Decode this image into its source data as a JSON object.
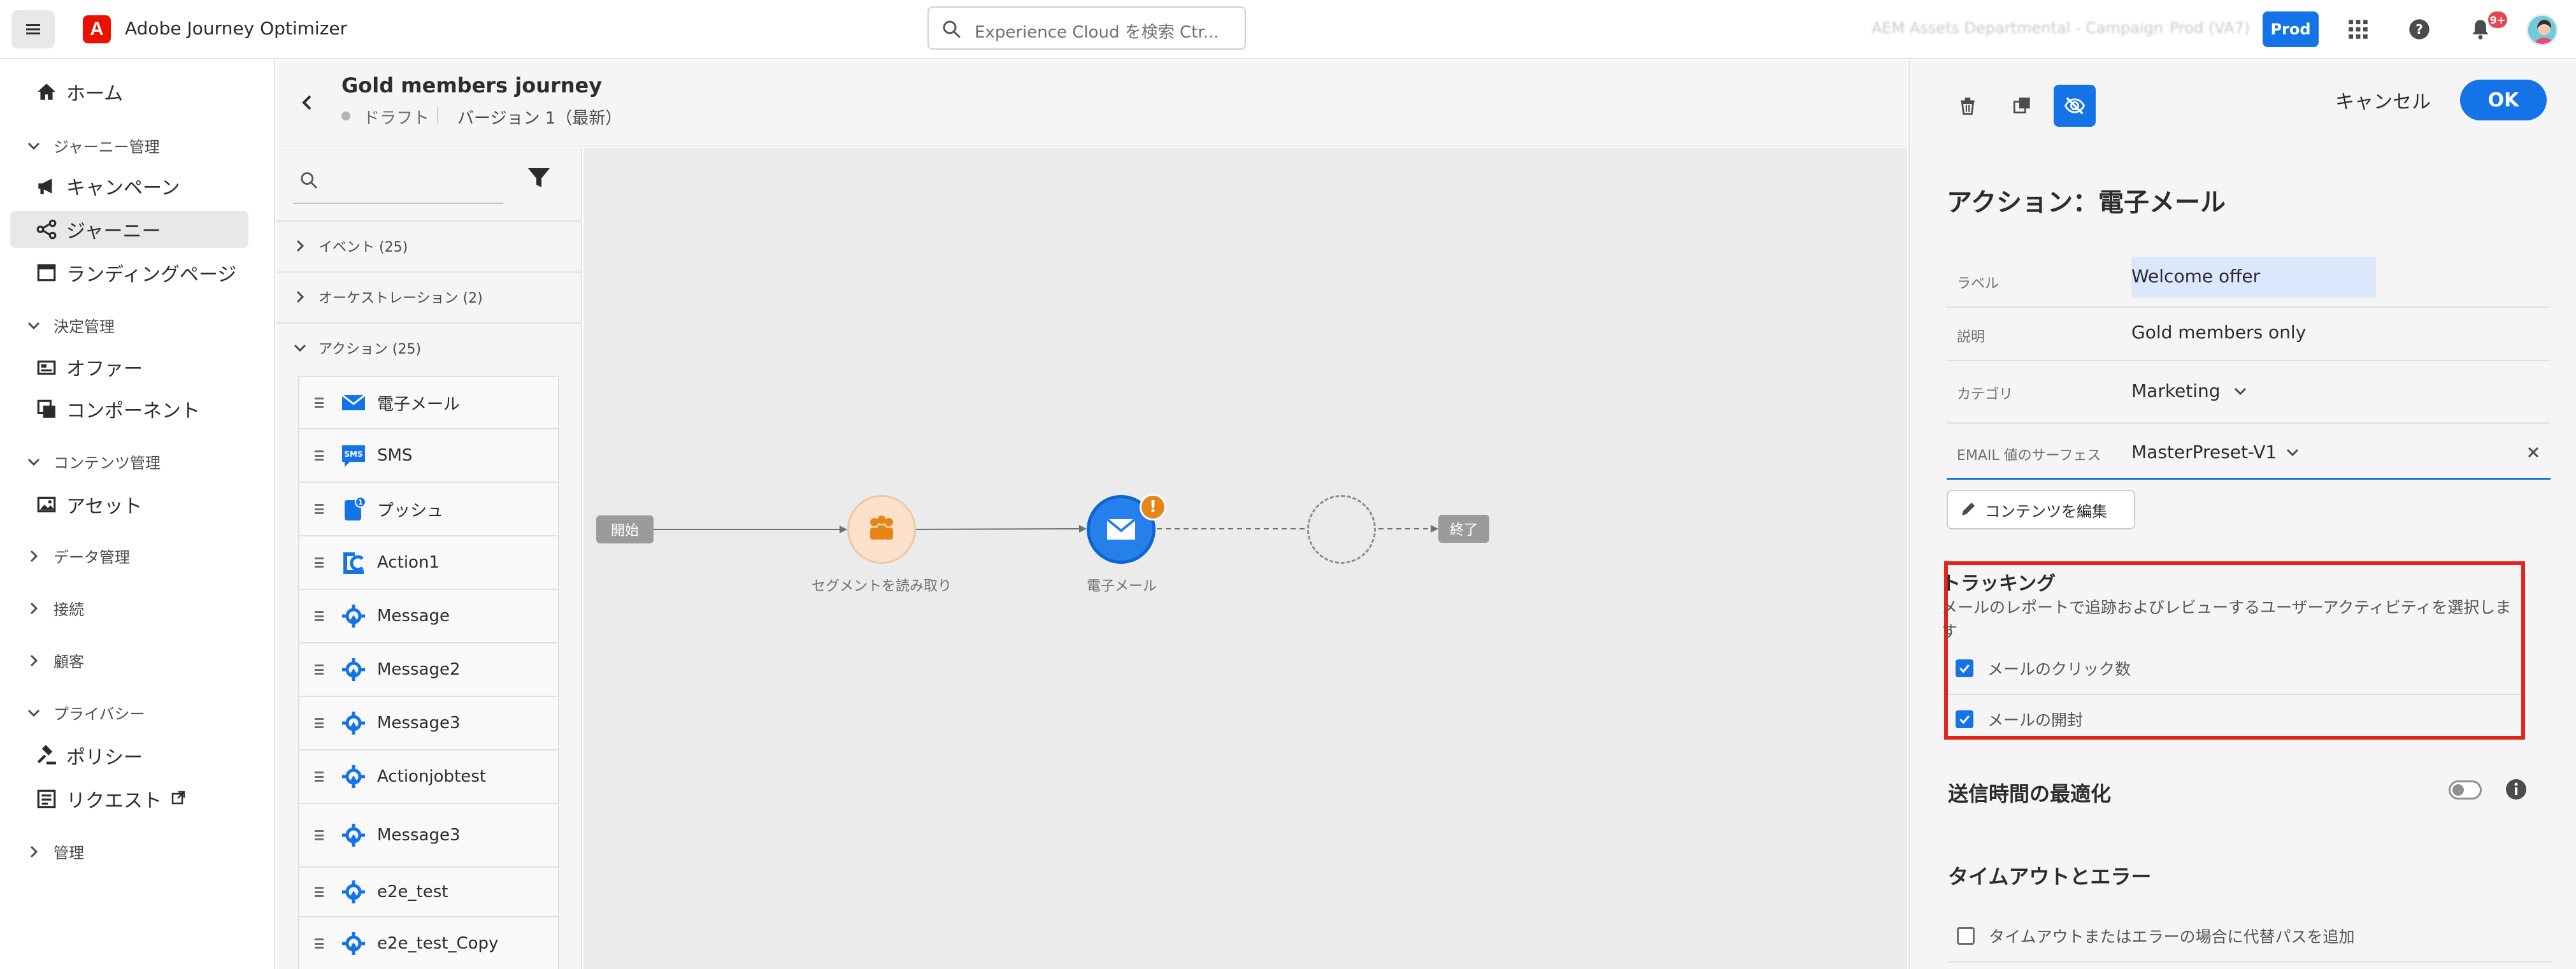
{
  "topbar": {
    "app_title": "Adobe Journey Optimizer",
    "search_placeholder": "Experience Cloud を検索 Ctr...",
    "org_name": "AEM Assets Departmental - Campaign",
    "sandbox_name": "Prod (VA7)",
    "env_button": "Prod",
    "notification_count": "9+"
  },
  "nav": {
    "home": "ホーム",
    "journey_mgmt": "ジャーニー管理",
    "campaigns": "キャンペーン",
    "journeys": "ジャーニー",
    "landing_pages": "ランディングページ",
    "decision_mgmt": "決定管理",
    "offers": "オファー",
    "components": "コンポーネント",
    "content_mgmt": "コンテンツ管理",
    "assets": "アセット",
    "data_mgmt": "データ管理",
    "connections": "接続",
    "customers": "顧客",
    "privacy": "プライバシー",
    "policies": "ポリシー",
    "requests": "リクエスト",
    "admin": "管理"
  },
  "journey": {
    "title": "Gold members journey",
    "status": "ドラフト",
    "version": "バージョン 1（最新）"
  },
  "palette": {
    "events": "イベント (25)",
    "orchestration": "オーケストレーション (2)",
    "actions": "アクション (25)",
    "items": [
      "電子メール",
      "SMS",
      "プッシュ",
      "Action1",
      "Message",
      "Message2",
      "Message3",
      "Actionjobtest",
      "Message3",
      "e2e_test",
      "e2e_test_Copy"
    ]
  },
  "canvas": {
    "start": "開始",
    "segment_label": "セグメントを読み取り",
    "email_label": "電子メール",
    "end": "終了"
  },
  "panel": {
    "cancel": "キャンセル",
    "ok": "OK",
    "title": "アクション：電子メール",
    "label_label": "ラベル",
    "label_value": "Welcome offer",
    "desc_label": "説明",
    "desc_value": "Gold members only",
    "category_label": "カテゴリ",
    "category_value": "Marketing",
    "surface_label": "EMAIL 値のサーフェス",
    "surface_value": "MasterPreset-V1",
    "edit_content": "コンテンツを編集",
    "tracking_title": "トラッキング",
    "tracking_desc": "メールのレポートで追跡およびレビューするユーザーアクティビティを選択します",
    "track_clicks": "メールのクリック数",
    "track_opens": "メールの開封",
    "send_time": "送信時間の最適化",
    "timeout_title": "タイムアウトとエラー",
    "timeout_option": "タイムアウトまたはエラーの場合に代替パスを追加"
  },
  "colors": {
    "accent": "#1473e6",
    "highlight": "#e3261d",
    "adobe_red": "#eb1000",
    "warning": "#e68619"
  }
}
